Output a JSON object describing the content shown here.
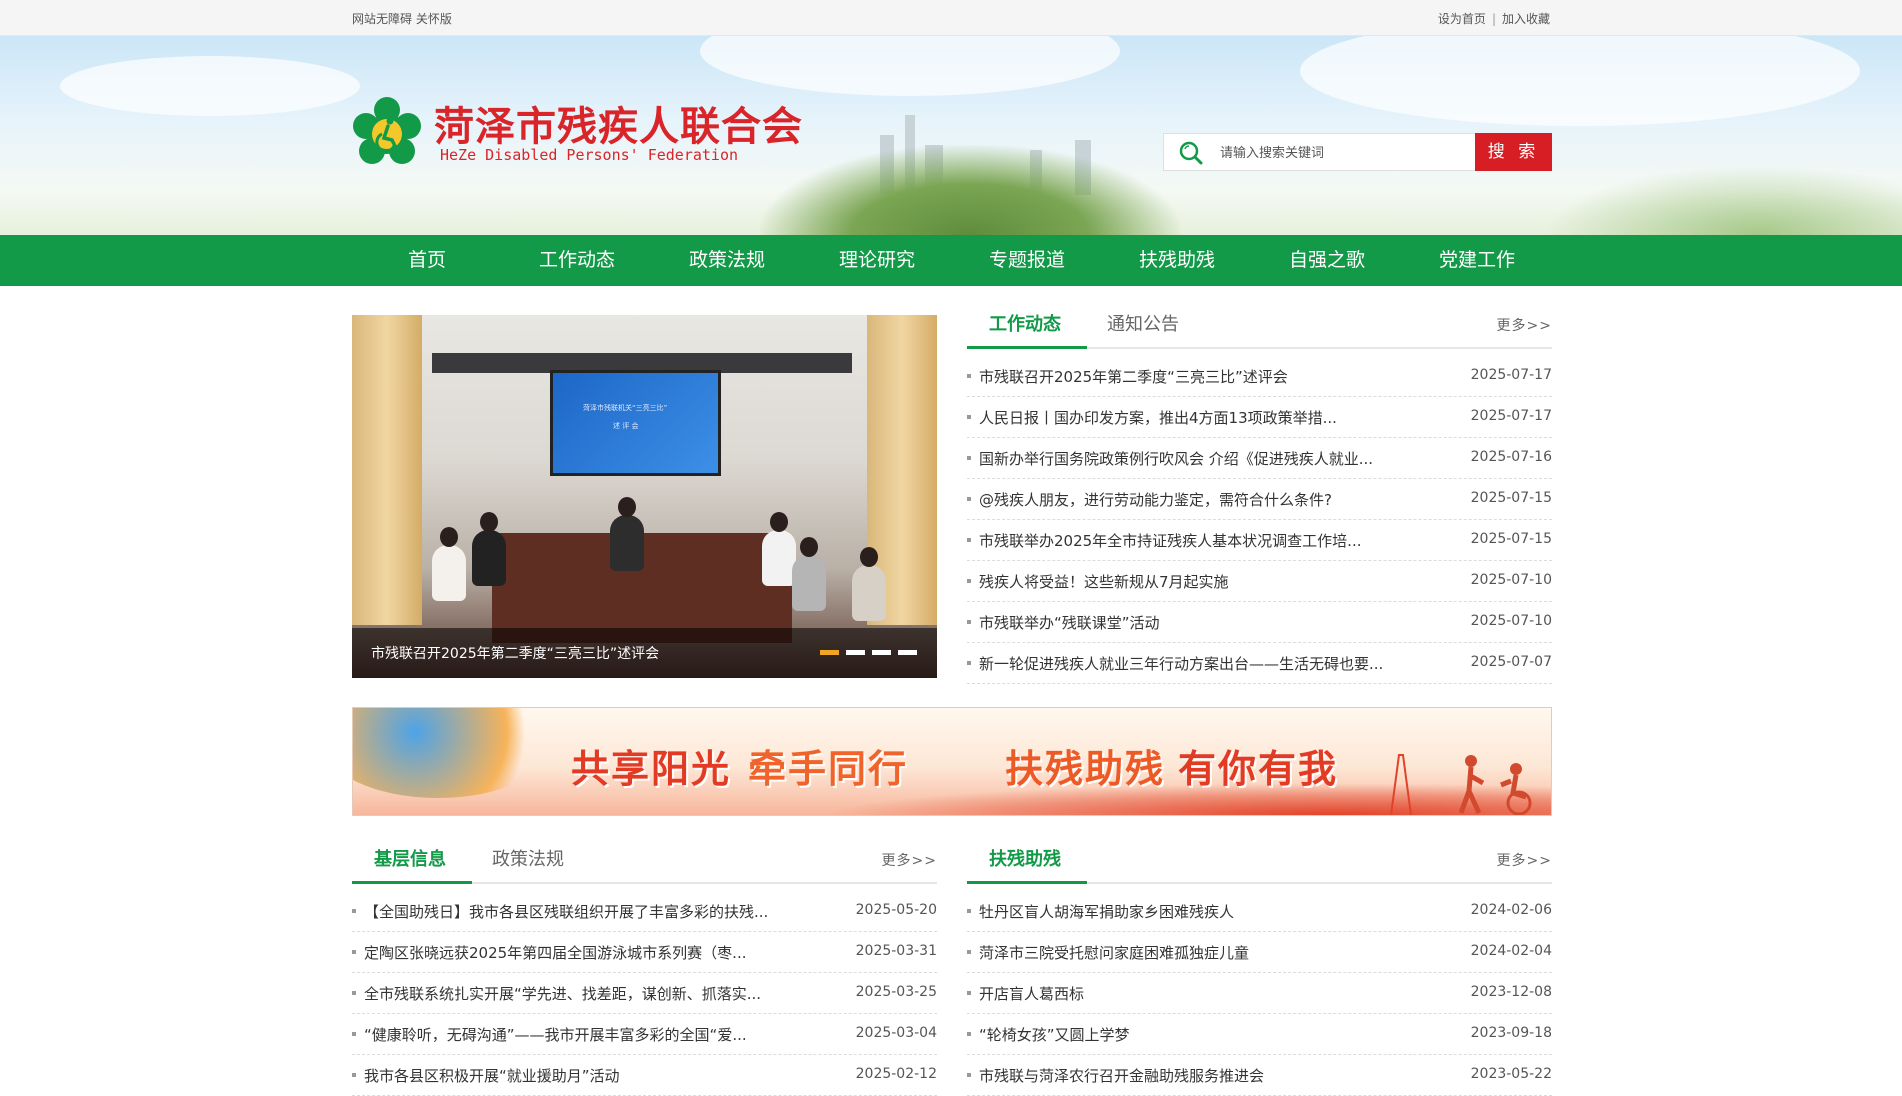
{
  "topbar": {
    "accessibility": "网站无障碍 关怀版",
    "set_home": "设为首页",
    "separator": "|",
    "favorite": "加入收藏"
  },
  "header": {
    "title_cn": "菏泽市残疾人联合会",
    "title_en": "HeZe Disabled Persons' Federation",
    "search_placeholder": "请输入搜索关键词",
    "search_button": "搜 索"
  },
  "nav": [
    "首页",
    "工作动态",
    "政策法规",
    "理论研究",
    "专题报道",
    "扶残助残",
    "自强之歌",
    "党建工作"
  ],
  "slider": {
    "caption": "市残联召开2025年第二季度“三亮三比”述评会",
    "screen_line1": "菏泽市残联机关“三亮三比”",
    "screen_line2": "述 评 会",
    "dots": 4,
    "active_dot": 0
  },
  "news_panel": {
    "tabs": [
      "工作动态",
      "通知公告"
    ],
    "more": "更多>>",
    "items": [
      {
        "title": "市残联召开2025年第二季度“三亮三比”述评会",
        "date": "2025-07-17"
      },
      {
        "title": "人民日报丨国办印发方案，推出4方面13项政策举措...",
        "date": "2025-07-17"
      },
      {
        "title": "国新办举行国务院政策例行吹风会 介绍《促进残疾人就业...",
        "date": "2025-07-16"
      },
      {
        "title": "@残疾人朋友，进行劳动能力鉴定，需符合什么条件?",
        "date": "2025-07-15"
      },
      {
        "title": "市残联举办2025年全市持证残疾人基本状况调查工作培...",
        "date": "2025-07-15"
      },
      {
        "title": "残疾人将受益！这些新规从7月起实施",
        "date": "2025-07-10"
      },
      {
        "title": "市残联举办“残联课堂”活动",
        "date": "2025-07-10"
      },
      {
        "title": "新一轮促进残疾人就业三年行动方案出台——生活无碍也要...",
        "date": "2025-07-07"
      }
    ]
  },
  "banner": {
    "text1": "共享阳光",
    "text2": "牵手同行",
    "text3": "扶残助残",
    "text4": "有你有我"
  },
  "grassroots_panel": {
    "tabs": [
      "基层信息",
      "政策法规"
    ],
    "more": "更多>>",
    "items": [
      {
        "title": "【全国助残日】我市各县区残联组织开展了丰富多彩的扶残...",
        "date": "2025-05-20"
      },
      {
        "title": "定陶区张晓远获2025年第四届全国游泳城市系列赛（枣...",
        "date": "2025-03-31"
      },
      {
        "title": "全市残联系统扎实开展“学先进、找差距，谋创新、抓落实...",
        "date": "2025-03-25"
      },
      {
        "title": "“健康聆听，无碍沟通”——我市开展丰富多彩的全国“爱...",
        "date": "2025-03-04"
      },
      {
        "title": "我市各县区积极开展“就业援助月”活动",
        "date": "2025-02-12"
      }
    ]
  },
  "help_panel": {
    "tabs": [
      "扶残助残"
    ],
    "more": "更多>>",
    "items": [
      {
        "title": "牡丹区盲人胡海军捐助家乡困难残疾人",
        "date": "2024-02-06"
      },
      {
        "title": "菏泽市三院受托慰问家庭困难孤独症儿童",
        "date": "2024-02-04"
      },
      {
        "title": "开店盲人葛西标",
        "date": "2023-12-08"
      },
      {
        "title": "“轮椅女孩”又圆上学梦",
        "date": "2023-09-18"
      },
      {
        "title": "市残联与菏泽农行召开金融助残服务推进会",
        "date": "2023-05-22"
      }
    ]
  },
  "colors": {
    "brand_green": "#129a49",
    "brand_red": "#d81e25",
    "slider_dot_active": "#f0a623"
  },
  "icons": {
    "search": "search-icon",
    "logo": "federation-emblem-icon"
  }
}
